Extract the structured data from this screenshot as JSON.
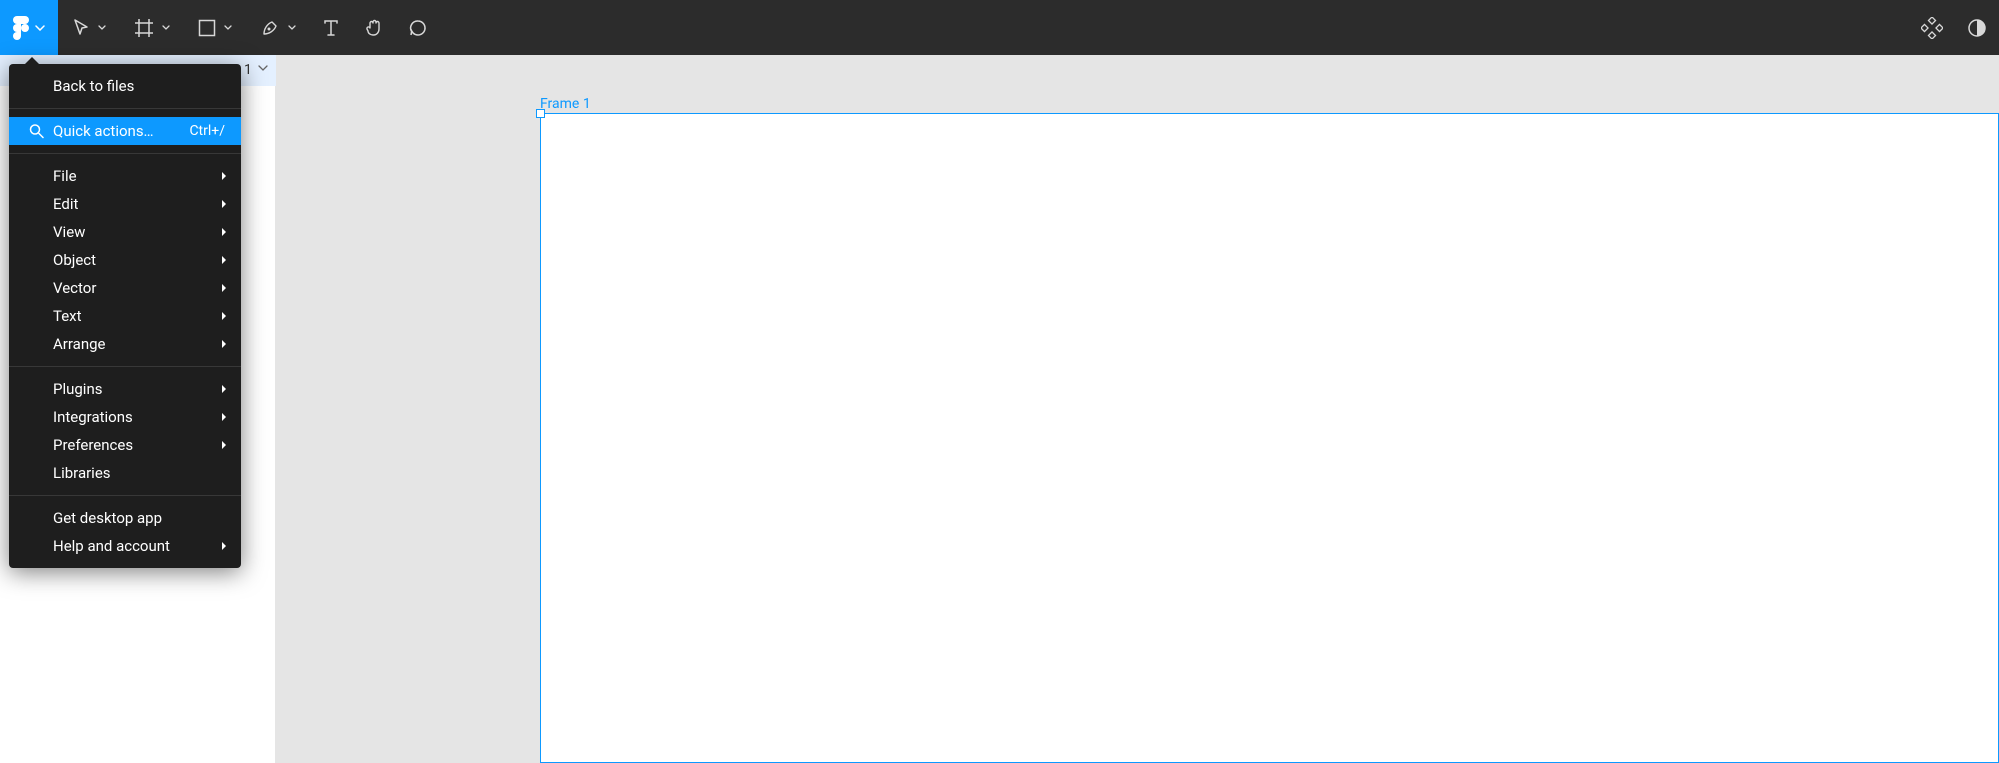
{
  "canvas": {
    "frame_label": "Frame 1",
    "panel_peek": "1"
  },
  "menu": {
    "back_to_files": "Back to files",
    "quick_actions": {
      "label": "Quick actions…",
      "shortcut": "Ctrl+/"
    },
    "file": "File",
    "edit": "Edit",
    "view": "View",
    "object": "Object",
    "vector": "Vector",
    "text": "Text",
    "arrange": "Arrange",
    "plugins": "Plugins",
    "integrations": "Integrations",
    "preferences": "Preferences",
    "libraries": "Libraries",
    "get_desktop": "Get desktop app",
    "help": "Help and account"
  },
  "toolbar_icons": {
    "logo": "figma-logo-icon",
    "move": "move-tool-icon",
    "frame": "frame-tool-icon",
    "shape": "rectangle-tool-icon",
    "pen": "pen-tool-icon",
    "text": "text-tool-icon",
    "hand": "hand-tool-icon",
    "comment": "comment-tool-icon",
    "components": "components-icon",
    "mask": "mask-icon"
  }
}
